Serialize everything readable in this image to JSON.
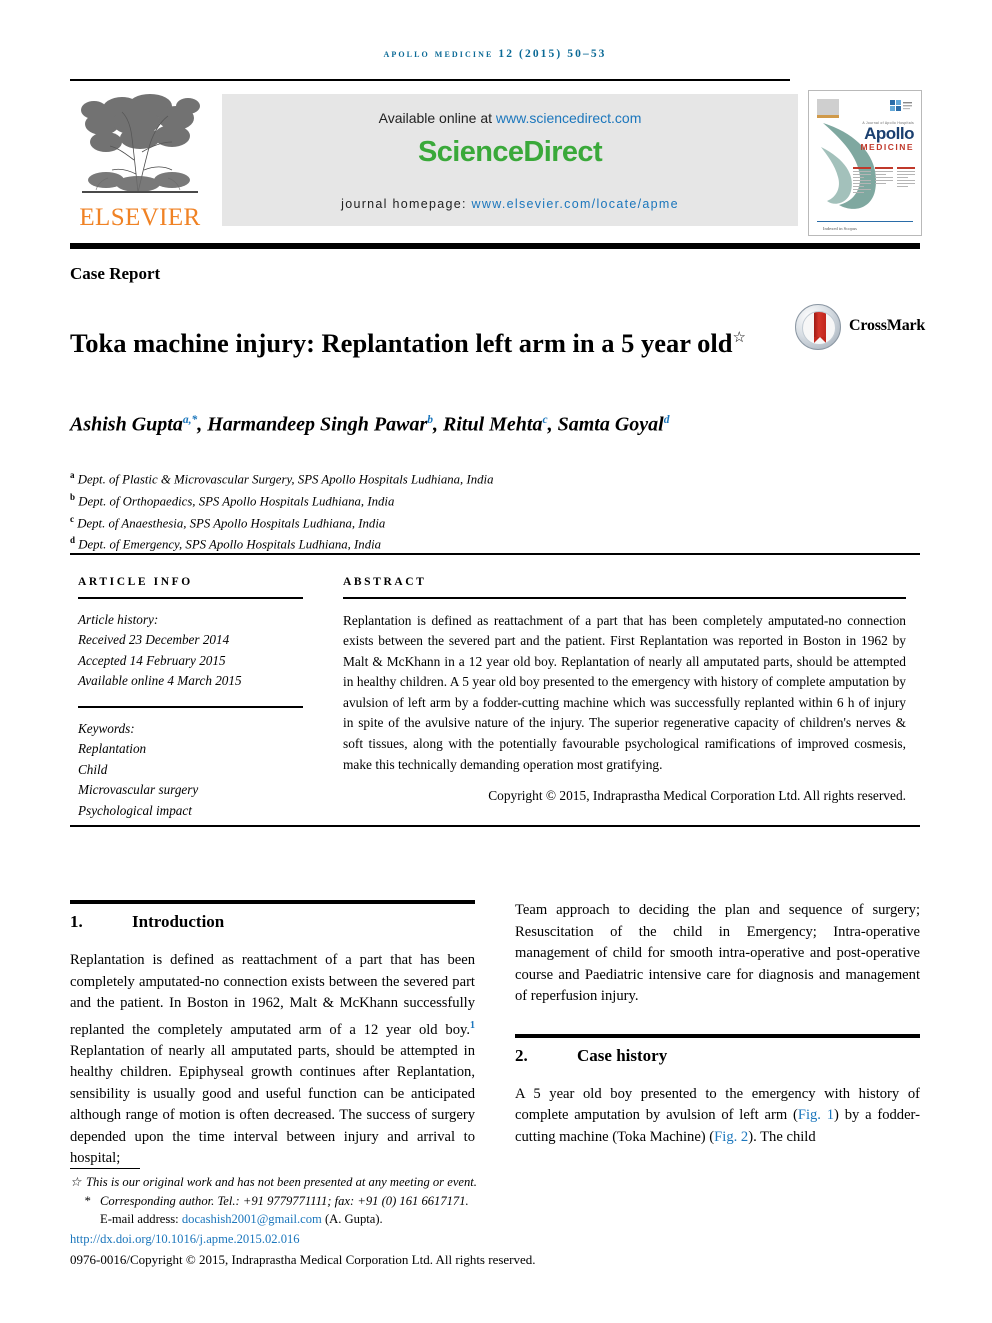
{
  "running_head": "Apollo medicine 12 (2015) 50–53",
  "masthead": {
    "publisher_name": "ELSEVIER",
    "available_prefix": "Available online at ",
    "available_url": "www.sciencedirect.com",
    "sciencedirect_logo": "ScienceDirect",
    "journal_homepage_label": "journal homepage: ",
    "journal_homepage_url": "www.elsevier.com/locate/apme",
    "cover": {
      "title": "Apollo",
      "subtitle": "MEDICINE",
      "tiny_line": "A Journal of Apollo Hospitals",
      "footnote": "Indexed in Scopus"
    }
  },
  "article": {
    "doctype": "Case Report",
    "title": "Toka machine injury: Replantation left arm in a 5 year old",
    "title_star": "☆",
    "crossmark_label": "CrossMark",
    "authors": [
      {
        "name": "Ashish Gupta",
        "marks": "a,*"
      },
      {
        "name": "Harmandeep Singh Pawar",
        "marks": "b"
      },
      {
        "name": "Ritul Mehta",
        "marks": "c"
      },
      {
        "name": "Samta Goyal",
        "marks": "d"
      }
    ],
    "affiliations": [
      {
        "mark": "a",
        "text": "Dept. of Plastic & Microvascular Surgery, SPS Apollo Hospitals Ludhiana, India"
      },
      {
        "mark": "b",
        "text": "Dept. of Orthopaedics, SPS Apollo Hospitals Ludhiana, India"
      },
      {
        "mark": "c",
        "text": "Dept. of Anaesthesia, SPS Apollo Hospitals Ludhiana, India"
      },
      {
        "mark": "d",
        "text": "Dept. of Emergency, SPS Apollo Hospitals Ludhiana, India"
      }
    ]
  },
  "info": {
    "heading": "ARTICLE INFO",
    "history_label": "Article history:",
    "received": "Received 23 December 2014",
    "accepted": "Accepted 14 February 2015",
    "available_online": "Available online 4 March 2015",
    "keywords_label": "Keywords:",
    "keywords": [
      "Replantation",
      "Child",
      "Microvascular surgery",
      "Psychological impact"
    ]
  },
  "abstract": {
    "heading": "ABSTRACT",
    "text": "Replantation is defined as reattachment of a part that has been completely amputated-no connection exists between the severed part and the patient. First Replantation was reported in Boston in 1962 by Malt & McKhann in a 12 year old boy. Replantation of nearly all amputated parts, should be attempted in healthy children. A 5 year old boy presented to the emergency with history of complete amputation by avulsion of left arm by a fodder-cutting machine which was successfully replanted within 6 h of injury in spite of the avulsive nature of the injury. The superior regenerative capacity of children's nerves & soft tissues, along with the potentially favourable psychological ramifications of improved cosmesis, make this technically demanding operation most gratifying.",
    "copyright": "Copyright © 2015, Indraprastha Medical Corporation Ltd. All rights reserved."
  },
  "sections": {
    "introduction": {
      "number": "1.",
      "title": "Introduction",
      "para1_a": "Replantation is defined as reattachment of a part that has been completely amputated-no connection exists between the severed part and the patient. In Boston in 1962, Malt & McKhann successfully replanted the completely amputated arm of a 12 year old boy.",
      "ref1": "1",
      "para1_b": " Replantation of nearly all amputated parts, should be attempted in healthy children. Epiphyseal growth continues after Replantation, sensibility is usually good and useful function can be anticipated although range of motion is often decreased. The success of surgery depended upon the time interval between injury and arrival to hospital;",
      "continued": "Team approach to deciding the plan and sequence of surgery; Resuscitation of the child in Emergency; Intra-operative management of child for smooth intra-operative and post-operative course and Paediatric intensive care for diagnosis and management of reperfusion injury."
    },
    "case_history": {
      "number": "2.",
      "title": "Case history",
      "para_a": "A 5 year old boy presented to the emergency with history of complete amputation by avulsion of left arm (",
      "fig1": "Fig. 1",
      "para_b": ") by a fodder-cutting machine (Toka Machine) (",
      "fig2": "Fig. 2",
      "para_c": "). The child"
    }
  },
  "footer": {
    "star_mark": "☆",
    "star_note": "This is our original work and has not been presented at any meeting or event.",
    "corr_mark": "*",
    "corr_note": "Corresponding author. Tel.: +91 9779771111; fax: +91 (0) 161 6617171.",
    "email_label": "E-mail address: ",
    "email": "docashish2001@gmail.com",
    "email_suffix": " (A. Gupta).",
    "doi": "http://dx.doi.org/10.1016/j.apme.2015.02.016",
    "issn_line": "0976-0016/Copyright © 2015, Indraprastha Medical Corporation Ltd. All rights reserved."
  },
  "colors": {
    "link_blue": "#1b76bc",
    "running_head_blue": "#0b6a96",
    "elsevier_orange": "#f08224",
    "sciencedirect_green": "#3aa93a",
    "banner_grey": "#e6e6e6"
  }
}
